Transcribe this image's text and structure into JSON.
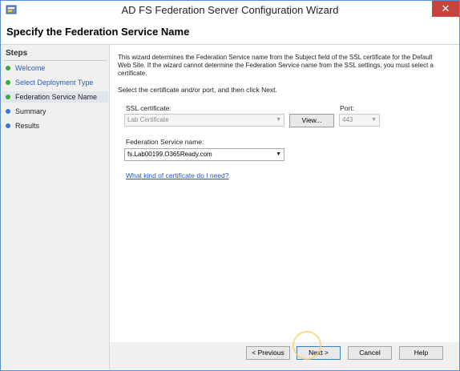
{
  "window": {
    "title": "AD FS Federation Server Configuration Wizard",
    "close_glyph": "✕"
  },
  "header": {
    "title": "Specify the Federation Service Name"
  },
  "steps": {
    "title": "Steps",
    "items": [
      {
        "label": "Welcome",
        "status": "complete"
      },
      {
        "label": "Select Deployment Type",
        "status": "complete"
      },
      {
        "label": "Federation Service Name",
        "status": "current"
      },
      {
        "label": "Summary",
        "status": "pending"
      },
      {
        "label": "Results",
        "status": "pending"
      }
    ]
  },
  "main": {
    "description": "This wizard determines the Federation Service name from the Subject field of the SSL certificate for the Default Web Site.  If the wizard cannot determine the Federation Service name from the SSL settings, you must select a certificate.",
    "instruction": "Select the certificate and/or port, and then click Next.",
    "ssl_label": "SSL certificate:",
    "ssl_value": "Lab Certificate",
    "view_button": "View...",
    "port_label": "Port:",
    "port_value": "443",
    "fs_name_label": "Federation Service name:",
    "fs_name_value": "fs.Lab00199.O365Ready.com",
    "help_link": "What kind of certificate do I need?"
  },
  "footer": {
    "previous": "< Previous",
    "next": "Next >",
    "cancel": "Cancel",
    "help": "Help"
  },
  "colors": {
    "step_complete": "#3ca83c",
    "step_pending": "#3e74d4",
    "close_button": "#c7433d",
    "link": "#1f56c4"
  }
}
